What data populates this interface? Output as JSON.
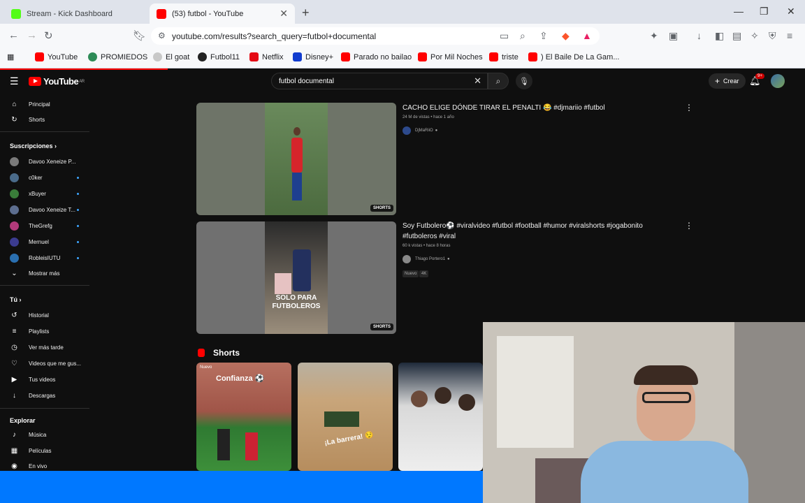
{
  "browser": {
    "tabs": [
      {
        "title": "Stream - Kick Dashboard",
        "favicon_color": "#53fc18",
        "active": false
      },
      {
        "title": "(53) futbol - YouTube",
        "favicon_color": "#ff0000",
        "active": true
      }
    ],
    "new_tab": "+",
    "url": "youtube.com/results?search_query=futbol+documental",
    "bookmarks": [
      {
        "label": "YouTube",
        "color": "#ff0000"
      },
      {
        "label": "PROMIEDOS",
        "color": "#2e8b57"
      },
      {
        "label": "El goat",
        "color": "#c8c8c8"
      },
      {
        "label": "Futbol11",
        "color": "#222222"
      },
      {
        "label": "Netflix",
        "color": "#e50914"
      },
      {
        "label": "Disney+",
        "color": "#113ccf"
      },
      {
        "label": "Parado no bailao",
        "color": "#ff0000"
      },
      {
        "label": "Por Mil Noches",
        "color": "#ff0000"
      },
      {
        "label": "triste",
        "color": "#ff0000"
      },
      {
        "label": ") El Baile De La Gam...",
        "color": "#ff0000"
      }
    ]
  },
  "youtube": {
    "logo_text": "YouTube",
    "logo_region": "AR",
    "search_value": "futbol documental",
    "create_label": "Crear",
    "notif_badge": "9+",
    "sidebar": {
      "main": [
        {
          "label": "Principal",
          "icon": "home-icon",
          "glyph": "⌂"
        },
        {
          "label": "Shorts",
          "icon": "shorts-icon",
          "glyph": "↻"
        }
      ],
      "subs_header": "Suscripciones",
      "subs": [
        {
          "label": "Davoo Xeneize P...",
          "color": "#7a7a7a"
        },
        {
          "label": "c0ker",
          "color": "#4a6b8a"
        },
        {
          "label": "xBuyer",
          "color": "#3a7d3a"
        },
        {
          "label": "Davoo Xeneize T...",
          "color": "#5d6e8f"
        },
        {
          "label": "TheGrefg",
          "color": "#b23a7a"
        },
        {
          "label": "Mernuel",
          "color": "#3b3b8f"
        },
        {
          "label": "RobleisIUTU",
          "color": "#2a6fb0"
        }
      ],
      "show_more": "Mostrar más",
      "you_header": "Tú",
      "you": [
        {
          "label": "Historial",
          "icon": "history-icon",
          "glyph": "↺"
        },
        {
          "label": "Playlists",
          "icon": "playlists-icon",
          "glyph": "≡"
        },
        {
          "label": "Ver más tarde",
          "icon": "watch-later-icon",
          "glyph": "◷"
        },
        {
          "label": "Videos que me gus...",
          "icon": "like-icon",
          "glyph": "👍"
        },
        {
          "label": "Tus videos",
          "icon": "your-videos-icon",
          "glyph": "▶"
        },
        {
          "label": "Descargas",
          "icon": "downloads-icon",
          "glyph": "↓"
        }
      ],
      "explore_header": "Explorar",
      "explore": [
        {
          "label": "Música",
          "icon": "music-icon",
          "glyph": "♪"
        },
        {
          "label": "Películas",
          "icon": "movies-icon",
          "glyph": "🎬"
        },
        {
          "label": "En vivo",
          "icon": "live-icon",
          "glyph": "◉"
        }
      ]
    },
    "results": [
      {
        "title": "CACHO ELIGE DÓNDE TIRAR EL PENALTI 😂 #djmariio #futbol",
        "meta": "24 M de vistas • hace 1 año",
        "channel": "DjMaRiiO",
        "badge": "SHORTS"
      },
      {
        "title": "Soy Futbolero⚽ #viralvideo #futbol #football #humor #viralshorts #jogabonito #futboleros #viral",
        "meta": "60 k vistas • hace 8 horas",
        "channel": "Thiago Portero1",
        "tags": [
          "Nuevo",
          "4K"
        ],
        "badge": "SHORTS",
        "overlay": "SOLO PARA\nFUTBOLEROS"
      }
    ],
    "shorts_header": "Shorts",
    "shorts": [
      {
        "caption": "Confianza ⚽",
        "new_label": "Nuevo"
      },
      {
        "caption": "¡La barrera! 😌"
      },
      {
        "caption": ""
      }
    ]
  }
}
